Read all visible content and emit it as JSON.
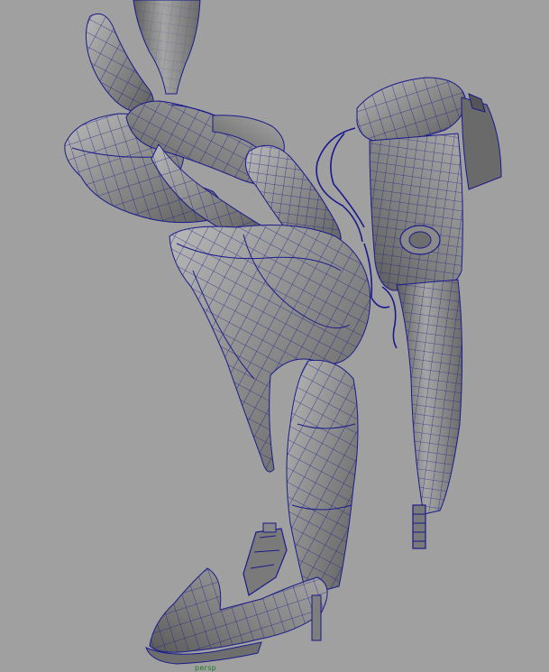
{
  "viewport": {
    "camera_name": "persp",
    "colors": {
      "background": "#a0a0a0",
      "mesh_fill_dark": "#6f6f6f",
      "mesh_fill_mid": "#8d8d8d",
      "mesh_fill_light": "#b5b5b5",
      "wireframe": "#1a1a8c",
      "camera_label": "#1e7a1e"
    }
  }
}
